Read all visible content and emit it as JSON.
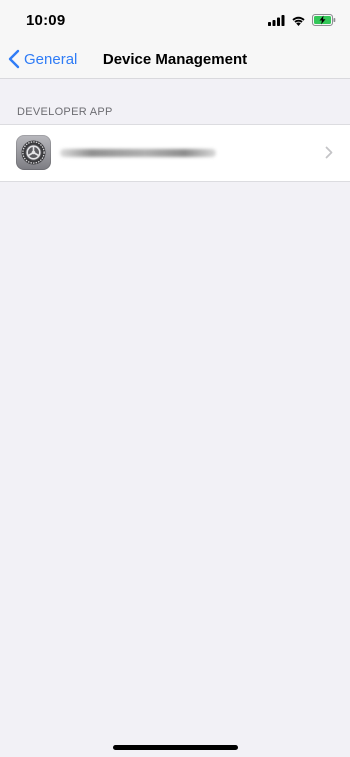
{
  "status_bar": {
    "time": "10:09",
    "icons": [
      "cellular-signal-icon",
      "wifi-icon",
      "battery-charging-icon"
    ]
  },
  "nav": {
    "back_label": "General",
    "title": "Device Management"
  },
  "section": {
    "header": "DEVELOPER APP"
  },
  "row": {
    "icon": "settings-gear-icon",
    "accessory": "chevron-right-icon"
  },
  "colors": {
    "accent": "#2f7cf6",
    "background": "#f2f1f6",
    "battery_green": "#34c759"
  }
}
